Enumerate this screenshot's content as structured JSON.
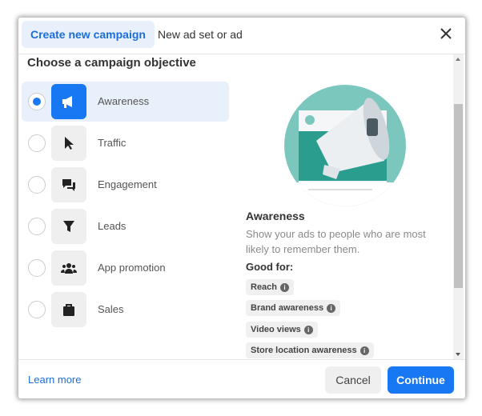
{
  "tabs": [
    {
      "label": "Create new campaign",
      "active": true
    },
    {
      "label": "New ad set or ad",
      "active": false
    }
  ],
  "title": "Choose a campaign objective",
  "objectives": [
    {
      "label": "Awareness",
      "icon": "megaphone-icon",
      "selected": true
    },
    {
      "label": "Traffic",
      "icon": "cursor-icon",
      "selected": false
    },
    {
      "label": "Engagement",
      "icon": "chat-bubbles-icon",
      "selected": false
    },
    {
      "label": "Leads",
      "icon": "funnel-icon",
      "selected": false
    },
    {
      "label": "App promotion",
      "icon": "people-icon",
      "selected": false
    },
    {
      "label": "Sales",
      "icon": "shopping-bag-icon",
      "selected": false
    }
  ],
  "detail": {
    "title": "Awareness",
    "description": "Show your ads to people who are most likely to remember them.",
    "good_for_label": "Good for:",
    "good_for": [
      "Reach",
      "Brand awareness",
      "Video views",
      "Store location awareness"
    ]
  },
  "footer": {
    "learn_more": "Learn more",
    "cancel": "Cancel",
    "continue": "Continue"
  },
  "colors": {
    "accent": "#1877f2",
    "selected_bg": "#e7f0fb",
    "illustration": "#7cc7bd"
  }
}
